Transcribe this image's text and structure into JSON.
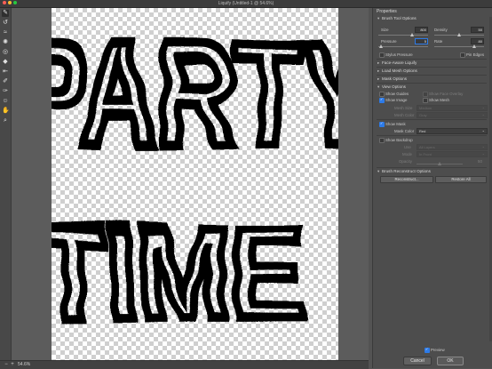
{
  "window": {
    "title": "Liquify (Untitled-1 @ 54.6%)"
  },
  "toolbar": {
    "tools": [
      {
        "name": "forward-warp-tool-icon",
        "glyph": "✎"
      },
      {
        "name": "reconstruct-tool-icon",
        "glyph": "↺"
      },
      {
        "name": "smooth-tool-icon",
        "glyph": "≈"
      },
      {
        "name": "twirl-tool-icon",
        "glyph": "✺"
      },
      {
        "name": "pucker-tool-icon",
        "glyph": "◎"
      },
      {
        "name": "bloat-tool-icon",
        "glyph": "◆"
      },
      {
        "name": "push-left-tool-icon",
        "glyph": "⇤"
      },
      {
        "name": "freeze-mask-tool-icon",
        "glyph": "✐"
      },
      {
        "name": "thaw-mask-tool-icon",
        "glyph": "✑"
      },
      {
        "name": "face-tool-icon",
        "glyph": "☺"
      },
      {
        "name": "hand-tool-icon",
        "glyph": "✋"
      },
      {
        "name": "zoom-tool-icon",
        "glyph": "⌕"
      }
    ]
  },
  "canvas": {
    "line1": "PARTY",
    "line2": "TIME"
  },
  "statusbar": {
    "zoom": "54.6%"
  },
  "properties": {
    "title": "Properties",
    "brush_tool_options": {
      "header": "Brush Tool Options",
      "size_label": "Size",
      "size_value": "800",
      "size_level": 0.68,
      "density_label": "Density",
      "density_value": "50",
      "density_level": 0.5,
      "pressure_label": "Pressure",
      "pressure_value": "5",
      "pressure_level": 0.05,
      "rate_label": "Rate",
      "rate_value": "80",
      "rate_level": 0.8,
      "stylus_pressure": "Stylus Pressure",
      "pin_edges": "Pin Edges"
    },
    "face_aware": "Face-Aware Liquify",
    "load_mesh": "Load Mesh Options",
    "mask_options": "Mask Options",
    "view_options": {
      "header": "View Options",
      "show_guides": "Show Guides",
      "show_face_overlay": "Show Face Overlay",
      "show_image": "Show Image",
      "show_mesh": "Show Mesh",
      "mesh_size_label": "Mesh Size",
      "mesh_size_value": "Medium",
      "mesh_color_label": "Mesh Color",
      "mesh_color_value": "Gray",
      "show_mask": "Show Mask",
      "mask_color_label": "Mask Color",
      "mask_color_value": "Red",
      "show_backdrop": "Show Backdrop",
      "use_label": "Use",
      "use_value": "All Layers",
      "mode_label": "Mode",
      "mode_value": "In Front",
      "opacity_label": "Opacity",
      "opacity_value": "50"
    },
    "brush_reconstruct": {
      "header": "Brush Reconstruct Options",
      "reconstruct": "Reconstruct...",
      "restore_all": "Restore All"
    }
  },
  "footer": {
    "preview": "Preview",
    "cancel": "Cancel",
    "ok": "OK"
  },
  "colors": {
    "accent": "#2d7be8",
    "panel": "#4d4d4d",
    "canvas_bg": "#5c5c5c"
  }
}
